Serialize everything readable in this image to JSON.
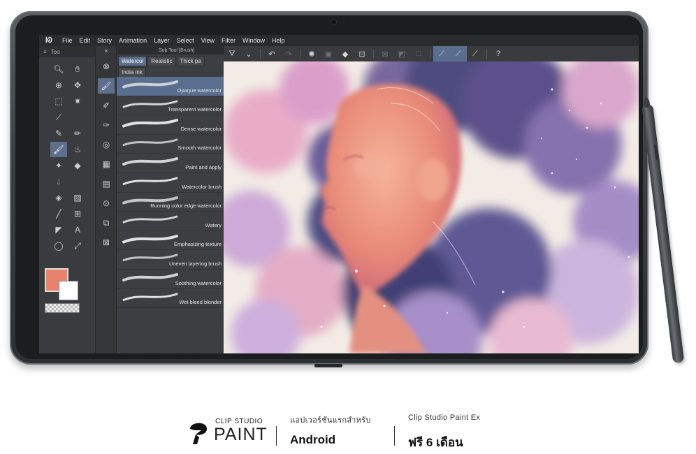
{
  "menu": {
    "logo": "ᘗ",
    "items": [
      "File",
      "Edit",
      "Story",
      "Animation",
      "Layer",
      "Select",
      "View",
      "Filter",
      "Window",
      "Help"
    ]
  },
  "tool_panel": {
    "header": "Too"
  },
  "sub_tool_panel": {
    "title": "Sub Tool [Brush]",
    "tabs": [
      "Watercol",
      "Realistic",
      "Thick pa",
      "India ink"
    ],
    "brushes": [
      "Opaque watercolor",
      "Transparent watercolor",
      "Dense watercolor",
      "Smooth watercolor",
      "Paint and apply",
      "Watercolor brush",
      "Running color edge watercolor",
      "Watery",
      "Emphasizing texture",
      "Uneven layering brush",
      "Soothing watercolor",
      "Wet bleed blender"
    ]
  },
  "colors": {
    "main": "#e8826f",
    "sub": "#ffffff",
    "accent": "#5a6f8f"
  },
  "footer": {
    "logo_top": "CLIP STUDIO",
    "logo_bottom": "PAINT",
    "col1_small": "แอปเวอร์ชันแรกสำหรับ",
    "col1_big": "Android",
    "col2_small": "Clip Studio Paint Ex",
    "col2_big": "ฟรี 6 เดือน"
  }
}
